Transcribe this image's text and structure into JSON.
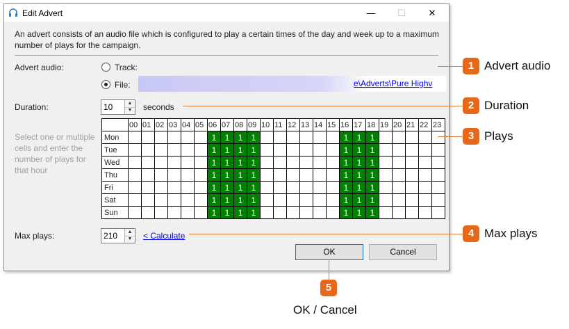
{
  "window": {
    "title": "Edit Advert",
    "minimize_glyph": "—",
    "maximize_glyph": "☐",
    "close_glyph": "✕"
  },
  "intro_text": "An advert consists of an audio file which is configured to play a certain times of the day and week up to a maximum number of plays for the campaign.",
  "advert_audio": {
    "label": "Advert audio:",
    "track_label": "Track:",
    "file_label": "File:",
    "file_path_visible": "e\\Adverts\\Pure Highv",
    "selected": "file"
  },
  "duration": {
    "label": "Duration:",
    "value": "10",
    "unit": "seconds"
  },
  "hint": "Select one or multiple cells and enter the number of plays for that hour",
  "plays_grid": {
    "hours": [
      "00",
      "01",
      "02",
      "03",
      "04",
      "05",
      "06",
      "07",
      "08",
      "09",
      "10",
      "11",
      "12",
      "13",
      "14",
      "15",
      "16",
      "17",
      "18",
      "19",
      "20",
      "21",
      "22",
      "23"
    ],
    "days": [
      "Mon",
      "Tue",
      "Wed",
      "Thu",
      "Fri",
      "Sat",
      "Sun"
    ],
    "active_hours": [
      "06",
      "07",
      "08",
      "09",
      "16",
      "17",
      "18"
    ],
    "plays_per_active_cell": "1",
    "active_color": "#008000"
  },
  "max_plays": {
    "label": "Max plays:",
    "value": "210",
    "calculate_link": "< Calculate"
  },
  "buttons": {
    "ok": "OK",
    "cancel": "Cancel"
  },
  "callouts": [
    {
      "number": "1",
      "label": "Advert audio"
    },
    {
      "number": "2",
      "label": "Duration"
    },
    {
      "number": "3",
      "label": "Plays"
    },
    {
      "number": "4",
      "label": "Max plays"
    },
    {
      "number": "5",
      "label": "OK / Cancel"
    }
  ],
  "colors": {
    "callout_orange": "#e8681a",
    "link_blue": "#0000ee",
    "dialog_bg": "#f0f0f0"
  }
}
